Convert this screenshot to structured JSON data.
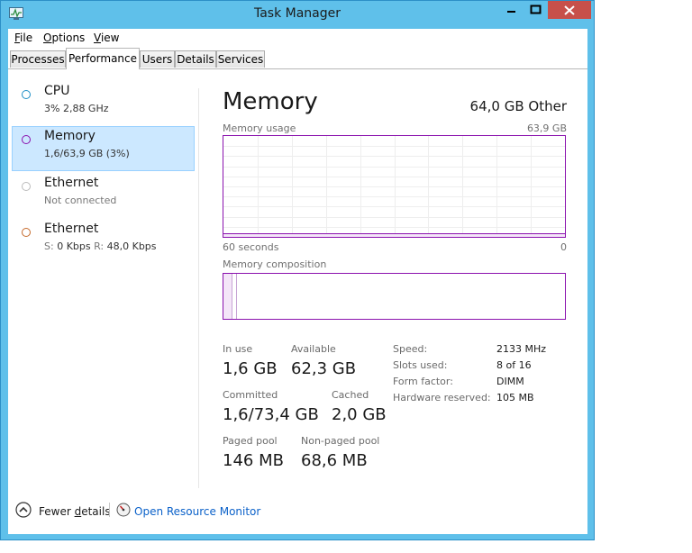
{
  "window": {
    "title": "Task Manager"
  },
  "menu": [
    {
      "accel": "F",
      "rest": "ile"
    },
    {
      "accel": "O",
      "rest": "ptions"
    },
    {
      "accel": "V",
      "rest": "iew"
    }
  ],
  "tabs": [
    "Processes",
    "Performance",
    "Users",
    "Details",
    "Services"
  ],
  "active_tab": "Performance",
  "sidebar": [
    {
      "title": "CPU",
      "sub": "3%  2,88 GHz",
      "color": "#1e8fc6"
    },
    {
      "title": "Memory",
      "sub": "1,6/63,9 GB (3%)",
      "color": "#8b12ae"
    },
    {
      "title": "Ethernet",
      "sub": "Not connected",
      "color": "#bbbbbb"
    },
    {
      "title": "Ethernet",
      "sub_s_label": "S:",
      "sub_s_value": "0 Kbps",
      "sub_r_label": "R:",
      "sub_r_value": "48,0 Kbps",
      "color": "#c56a2c"
    }
  ],
  "memory": {
    "heading": "Memory",
    "total_label": "64,0 GB Other",
    "usage_label": "Memory usage",
    "usage_max": "63,9 GB",
    "axis_left": "60 seconds",
    "axis_right": "0",
    "usage_level": 0.03,
    "composition_label": "Memory composition",
    "composition": {
      "in_use": 0.025,
      "modified": 0.01
    },
    "accent": "#8b12ae",
    "stats": {
      "in_use_label": "In use",
      "in_use_value": "1,6 GB",
      "available_label": "Available",
      "available_value": "62,3 GB",
      "committed_label": "Committed",
      "committed_value": "1,6/73,4 GB",
      "cached_label": "Cached",
      "cached_value": "2,0 GB",
      "paged_label": "Paged pool",
      "paged_value": "146 MB",
      "nonpaged_label": "Non-paged pool",
      "nonpaged_value": "68,6 MB"
    },
    "details": [
      {
        "key": "Speed:",
        "value": "2133 MHz"
      },
      {
        "key": "Slots used:",
        "value": "8 of 16"
      },
      {
        "key": "Form factor:",
        "value": "DIMM"
      },
      {
        "key": "Hardware reserved:",
        "value": "105 MB"
      }
    ]
  },
  "footer": {
    "fewer_accel": "d",
    "fewer_pre": "Fewer ",
    "fewer_post": "etails",
    "resource_monitor": "Open Resource Monitor"
  }
}
